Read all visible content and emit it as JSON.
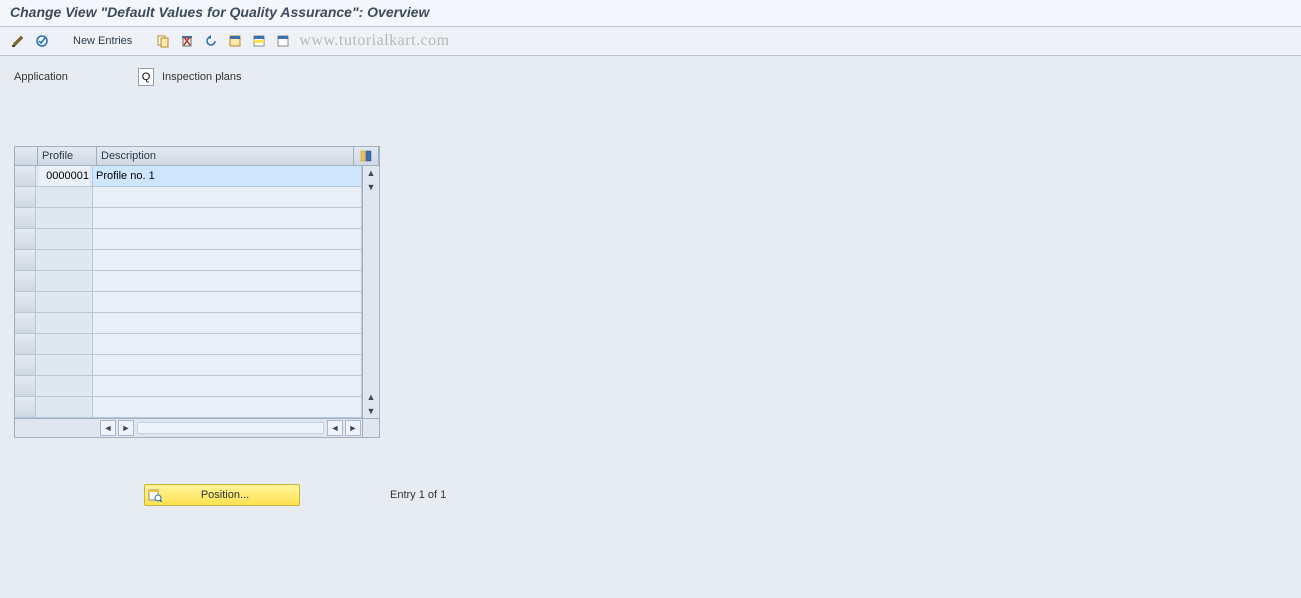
{
  "title": "Change View \"Default Values for Quality Assurance\": Overview",
  "toolbar": {
    "new_entries": "New Entries"
  },
  "watermark": "www.tutorialkart.com",
  "field": {
    "label": "Application",
    "value": "Q",
    "desc": "Inspection plans"
  },
  "table": {
    "columns": {
      "profile": "Profile",
      "description": "Description"
    },
    "rows": [
      {
        "profile": "0000001",
        "description": "Profile no. 1"
      },
      {
        "profile": "",
        "description": ""
      },
      {
        "profile": "",
        "description": ""
      },
      {
        "profile": "",
        "description": ""
      },
      {
        "profile": "",
        "description": ""
      },
      {
        "profile": "",
        "description": ""
      },
      {
        "profile": "",
        "description": ""
      },
      {
        "profile": "",
        "description": ""
      },
      {
        "profile": "",
        "description": ""
      },
      {
        "profile": "",
        "description": ""
      },
      {
        "profile": "",
        "description": ""
      },
      {
        "profile": "",
        "description": ""
      }
    ]
  },
  "position_button": "Position...",
  "entry_info": "Entry 1 of 1"
}
